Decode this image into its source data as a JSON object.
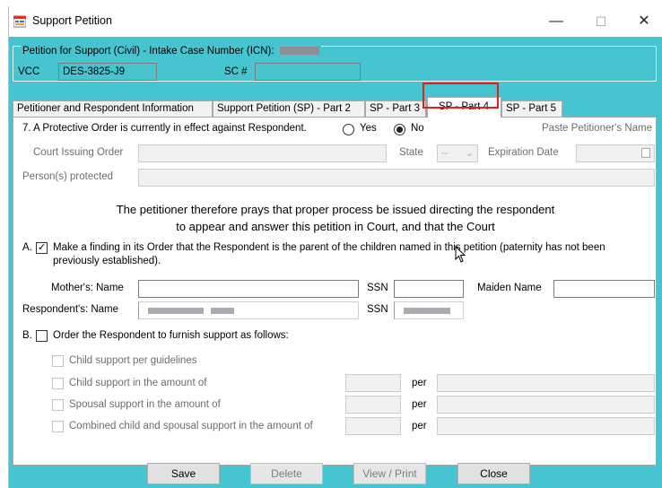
{
  "window": {
    "title": "Support Petition",
    "controls": {
      "minimize": "—",
      "maximize": "☐",
      "close": "✕"
    }
  },
  "header": {
    "group_label": "Petition for Support (Civil) - Intake Case Number (ICN):",
    "vcc_label": "VCC",
    "vcc_value": "DES-3825-J9",
    "sc_label": "SC #",
    "sc_value": ""
  },
  "tabs": [
    {
      "label": "Petitioner and Respondent Information",
      "active": false
    },
    {
      "label": "Support Petition (SP) - Part 2",
      "active": false
    },
    {
      "label": "SP - Part 3",
      "active": false
    },
    {
      "label": "SP - Part 4",
      "active": true
    },
    {
      "label": "SP - Part 5",
      "active": false
    }
  ],
  "protective_order": {
    "question": "7. A Protective Order is currently in effect against Respondent.",
    "yes_label": "Yes",
    "no_label": "No",
    "selected": "No",
    "paste_link": "Paste Petitioner's Name",
    "court_label": "Court Issuing Order",
    "court_value": "",
    "state_label": "State",
    "state_value": "--",
    "expiration_label": "Expiration Date",
    "expiration_value": "",
    "persons_label": "Person(s) protected",
    "persons_value": ""
  },
  "prayer": {
    "line1": "The petitioner therefore prays that proper process be issued directing the respondent",
    "line2": "to appear and answer this petition in Court, and that the Court"
  },
  "section_a": {
    "letter": "A.",
    "checked": true,
    "text_line1": "Make a finding in its Order that the Respondent is the parent of the children named in this petition (paternity has not been",
    "text_line2": "previously established).",
    "mothers_name_label": "Mother's: Name",
    "mothers_name_value": "",
    "ssn_label": "SSN",
    "ssn_value": "",
    "maiden_name_label": "Maiden Name",
    "maiden_name_value": "",
    "respondents_name_label": "Respondent's: Name",
    "respondent_ssn_label": "SSN"
  },
  "section_b": {
    "letter": "B.",
    "checked": false,
    "text": "Order the Respondent to furnish support as follows:",
    "items": [
      {
        "label": "Child support per guidelines",
        "has_amount": false
      },
      {
        "label": "Child support in the amount of",
        "has_amount": true,
        "per_label": "per"
      },
      {
        "label": "Spousal support in the amount of",
        "has_amount": true,
        "per_label": "per"
      },
      {
        "label": "Combined child and spousal support in the amount of",
        "has_amount": true,
        "per_label": "per"
      }
    ]
  },
  "buttons": {
    "save": "Save",
    "delete": "Delete",
    "view_print": "View / Print",
    "close": "Close"
  },
  "colors": {
    "accent_teal": "#46c4cf",
    "tab_highlight": "#e0201c"
  }
}
